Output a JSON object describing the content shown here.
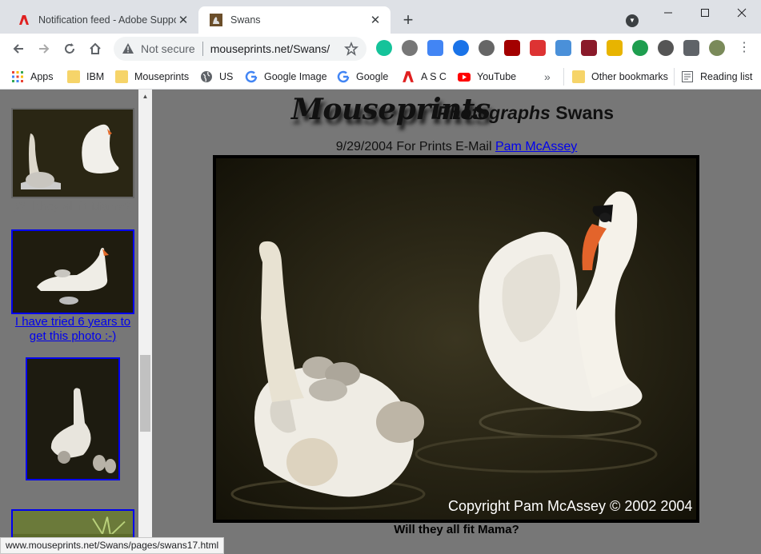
{
  "tabs": [
    {
      "title": "Notification feed - Adobe Support",
      "icon": "adobe-icon",
      "active": false
    },
    {
      "title": "Swans",
      "icon": "swan-favicon",
      "active": true
    }
  ],
  "omnibox": {
    "security_label": "Not secure",
    "url": "mouseprints.net/Swans/"
  },
  "bookmarks": [
    {
      "label": "Apps",
      "icon": "apps-grid-icon"
    },
    {
      "label": "IBM",
      "icon": "folder-icon"
    },
    {
      "label": "Mouseprints",
      "icon": "folder-icon"
    },
    {
      "label": "US",
      "icon": "globe-icon"
    },
    {
      "label": "Google Image",
      "icon": "google-icon"
    },
    {
      "label": "Google",
      "icon": "google-icon"
    },
    {
      "label": "A S C",
      "icon": "adobe-icon"
    },
    {
      "label": "YouTube",
      "icon": "youtube-icon"
    },
    {
      "label": "Other bookmarks",
      "icon": "folder-icon"
    },
    {
      "label": "Reading list",
      "icon": "reading-list-icon"
    }
  ],
  "sidebar": {
    "thumbnails": [
      {
        "caption": "Will they all fit Mama?",
        "visited": true
      },
      {
        "caption": "I have tried 6 years to get this photo :-)",
        "visited": false
      },
      {
        "caption": "",
        "visited": false
      },
      {
        "caption": "",
        "visited": false
      }
    ]
  },
  "main": {
    "logo_text": "Mouseprints",
    "heading_italic": "Photographs",
    "heading_rest": "Swans",
    "date_prefix": "9/29/2004 For Prints E-Mail",
    "contact_link": "Pam McAssey",
    "photo_copyright": "Copyright Pam McAssey © 2002 2004",
    "photo_caption": "Will they all fit Mama?"
  },
  "status_url": "www.mouseprints.net/Swans/pages/swans17.html",
  "colors": {
    "link": "#0000ee",
    "visited": "#777777",
    "page_bg": "#777777"
  }
}
